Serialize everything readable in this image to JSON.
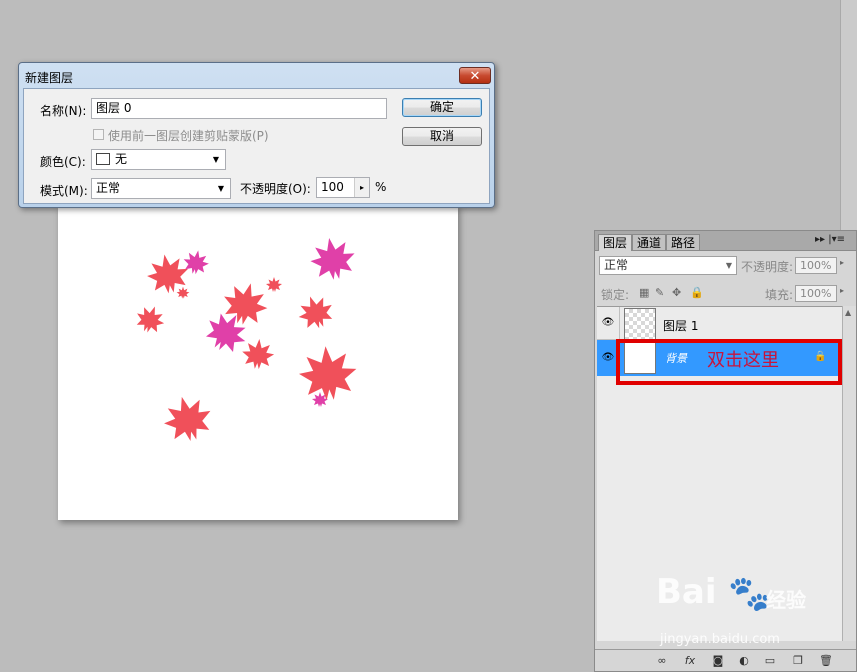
{
  "dialog": {
    "title": "新建图层",
    "close_glyph": "✕",
    "name_label": "名称(N):",
    "name_value": "图层 0",
    "clip_checkbox_label": "使用前一图层创建剪贴蒙版(P)",
    "color_label": "颜色(C):",
    "color_value": "无",
    "mode_label": "模式(M):",
    "mode_value": "正常",
    "opacity_label": "不透明度(O):",
    "opacity_value": "100",
    "opacity_unit": "%",
    "ok_label": "确定",
    "cancel_label": "取消"
  },
  "layers_panel": {
    "tabs": [
      "图层",
      "通道",
      "路径"
    ],
    "menu_glyph": "▸▸ |▾≡",
    "blend_mode": "正常",
    "opacity_label": "不透明度:",
    "opacity_value": "100%",
    "lock_label": "锁定:",
    "fill_label": "填充:",
    "fill_value": "100%",
    "layers": [
      {
        "name": "图层 1",
        "selected": false
      },
      {
        "name": "背景",
        "selected": true
      }
    ],
    "annotation": "双击这里",
    "highlight_color": "#e00000",
    "selection_color": "#3399ff"
  },
  "watermark": {
    "brand": "Bai",
    "brand_tail": "经验",
    "url": "jingyan.baidu.com"
  }
}
